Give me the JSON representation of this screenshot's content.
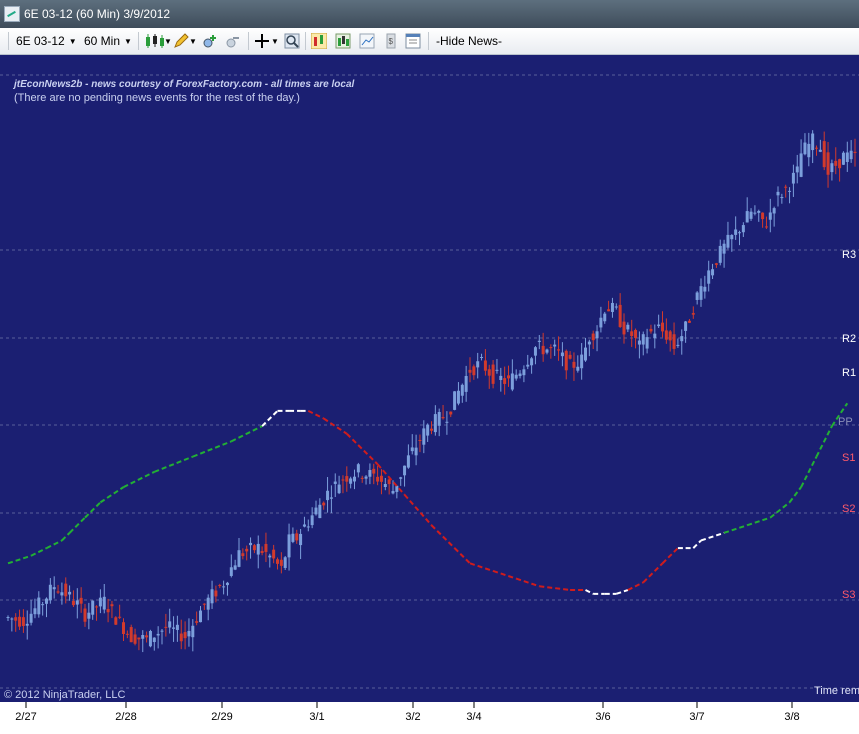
{
  "window": {
    "title": "6E 03-12 (60 Min)  3/9/2012"
  },
  "toolbar": {
    "instrument": "6E 03-12",
    "interval": "60 Min",
    "hide_news": "-Hide News-"
  },
  "news": {
    "header": "jtEconNews2b - news courtesy of ForexFactory.com - all times are local",
    "message": "(There are no pending news events for the rest of the day.)"
  },
  "copyright": "© 2012 NinjaTrader, LLC",
  "time_remaining_label": "Time rem",
  "colors": {
    "background": "#1b1f72",
    "up_candle": "#7c9fdc",
    "down_candle": "#d23a2c",
    "ma_falling": "#d01c1c",
    "ma_rising": "#22b034",
    "ma_flat": "#ffffff",
    "grid": "#5a5f9a",
    "pivot_r": "#ffffff",
    "pivot_s": "#ff5a6a"
  },
  "chart_data": {
    "type": "line",
    "x_tick_labels": [
      "2/27",
      "2/28",
      "2/29",
      "3/1",
      "3/2",
      "3/4",
      "3/6",
      "3/7",
      "3/8"
    ],
    "pivot_labels": [
      "R3",
      "R2",
      "R1",
      "PP",
      "S1",
      "S2",
      "S3"
    ],
    "price_series": {
      "x": [
        0,
        5,
        10,
        13,
        16,
        19,
        21,
        23,
        26,
        29,
        33,
        37,
        42,
        47,
        52,
        57,
        61,
        66,
        70,
        72,
        74,
        76,
        77,
        80,
        84,
        88,
        92,
        97,
        101,
        105,
        110,
        115,
        118,
        121,
        124,
        127,
        131,
        134,
        138,
        143,
        147,
        150,
        152,
        154,
        156,
        157,
        159,
        161,
        163,
        165,
        167,
        170,
        172,
        174,
        177,
        180,
        183,
        187,
        190,
        194,
        198,
        200,
        203,
        206,
        207,
        210,
        212,
        214,
        218
      ],
      "close": [
        30,
        28,
        40,
        50,
        45,
        38,
        32,
        36,
        40,
        30,
        18,
        16,
        24,
        18,
        38,
        52,
        70,
        74,
        66,
        60,
        78,
        80,
        84,
        94,
        108,
        118,
        122,
        118,
        110,
        130,
        150,
        158,
        172,
        186,
        190,
        182,
        178,
        186,
        200,
        198,
        188,
        192,
        207,
        212,
        225,
        225,
        222,
        212,
        208,
        200,
        208,
        212,
        208,
        200,
        212,
        232,
        248,
        263,
        272,
        285,
        278,
        292,
        300,
        310,
        322,
        330,
        326,
        310,
        320
      ]
    },
    "moving_average": {
      "x": [
        0,
        6,
        10,
        14,
        16,
        20,
        24,
        30,
        38,
        48,
        58,
        66,
        70,
        73,
        76,
        78,
        82,
        88,
        96,
        103,
        110,
        116,
        120,
        126,
        132,
        138,
        146,
        150,
        152,
        155,
        158,
        161,
        165,
        170,
        174,
        176,
        178,
        180,
        186,
        192,
        198,
        203,
        206,
        210,
        214,
        218
      ],
      "y": [
        10,
        12,
        14,
        16,
        18,
        22,
        26,
        30,
        34,
        38,
        42,
        46,
        50,
        50,
        50,
        50,
        48,
        44,
        36,
        28,
        20,
        14,
        10,
        8,
        6,
        4,
        3,
        3,
        2,
        2,
        2,
        3,
        5,
        10,
        14,
        14,
        14,
        16,
        18,
        20,
        22,
        26,
        30,
        38,
        46,
        52
      ],
      "state": [
        "up",
        "up",
        "up",
        "up",
        "up",
        "up",
        "up",
        "up",
        "up",
        "up",
        "up",
        "flat",
        "flat",
        "flat",
        "flat",
        "down",
        "down",
        "down",
        "down",
        "down",
        "down",
        "down",
        "down",
        "down",
        "down",
        "down",
        "down",
        "flat",
        "flat",
        "flat",
        "flat",
        "down",
        "down",
        "down",
        "flat",
        "flat",
        "flat",
        "flat",
        "up",
        "up",
        "up",
        "up",
        "up",
        "up",
        "up",
        "up"
      ]
    },
    "grid": true
  }
}
